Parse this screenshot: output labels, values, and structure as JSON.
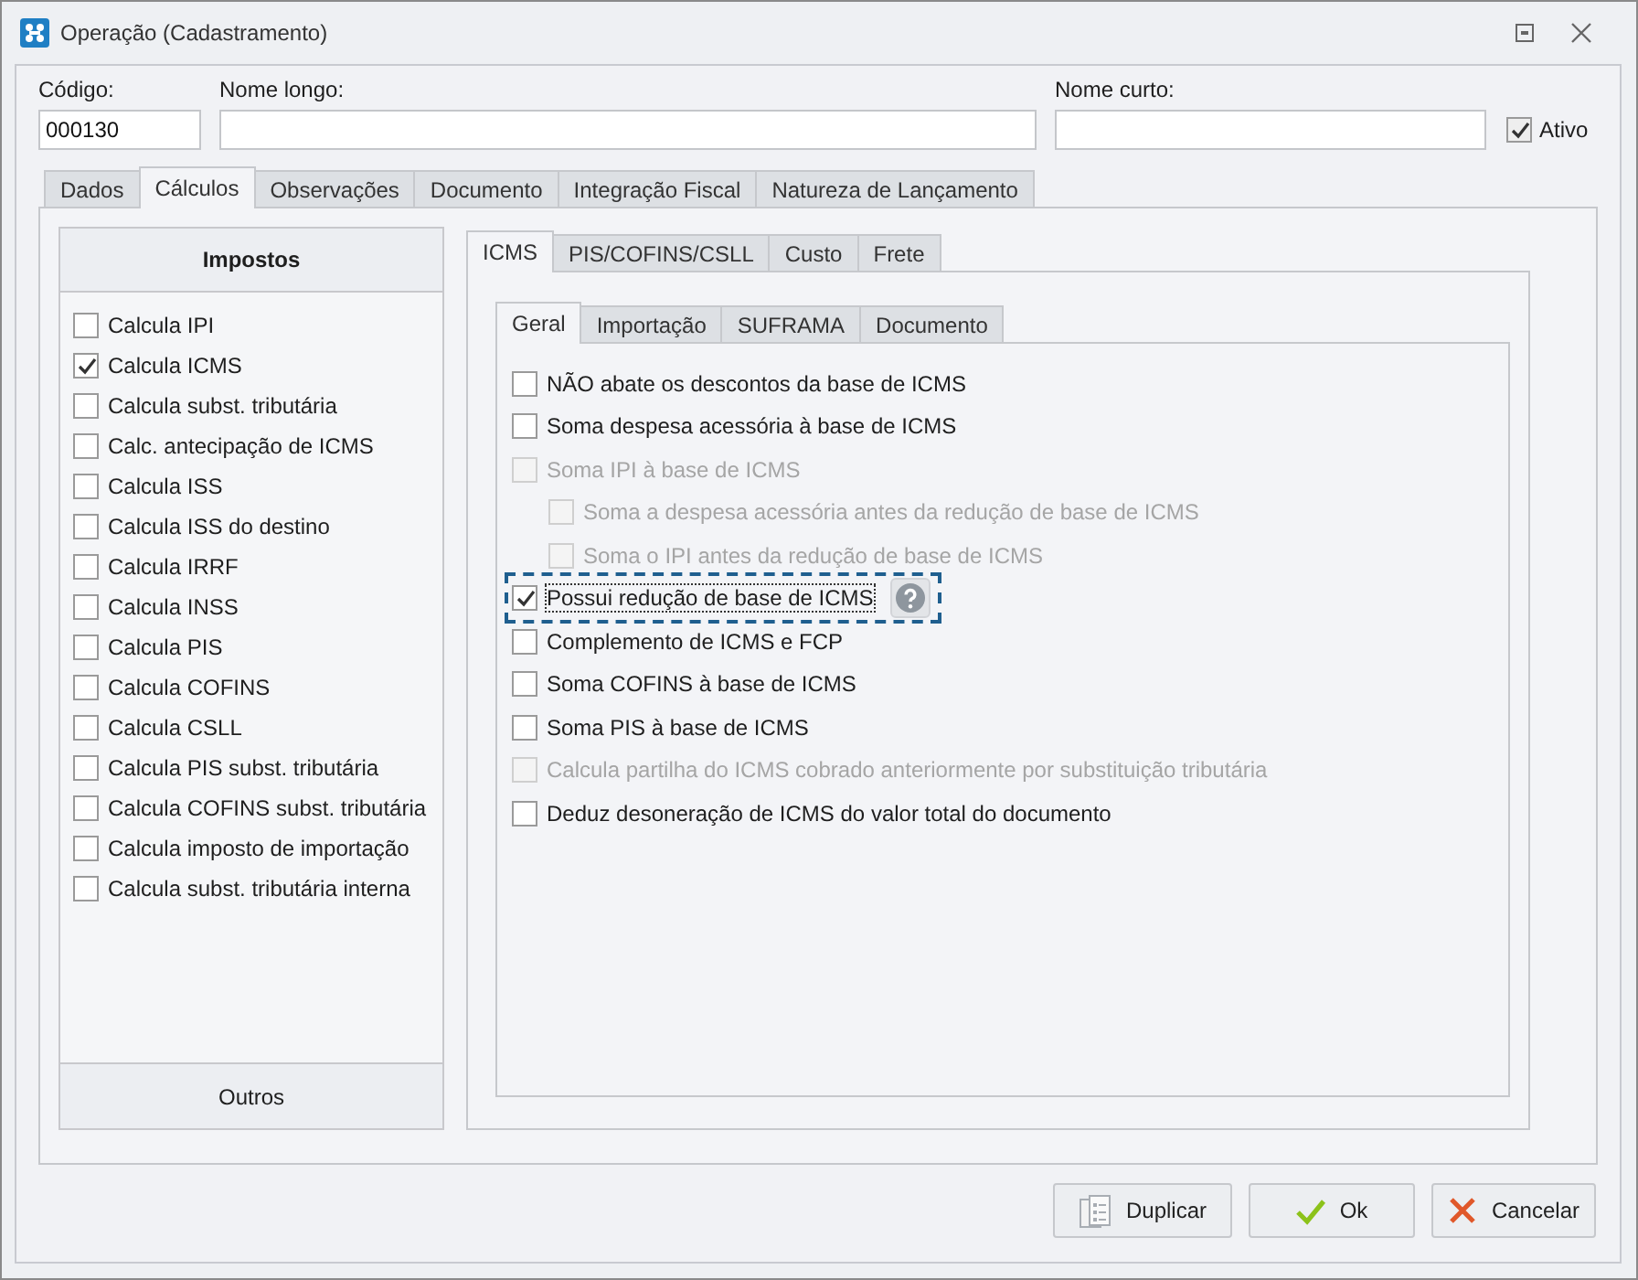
{
  "window": {
    "title": "Operação (Cadastramento)"
  },
  "fields": [
    {
      "label": "Código:",
      "value": "000130",
      "kind": "code"
    },
    {
      "label": "Nome longo:",
      "kind": "long"
    },
    {
      "label": "Nome curto:",
      "kind": "short"
    }
  ],
  "ativo": {
    "label": "Ativo",
    "checked": true
  },
  "tabs": [
    {
      "label": "Dados",
      "selected": false
    },
    {
      "label": "Cálculos",
      "selected": true
    },
    {
      "label": "Observações",
      "selected": false
    },
    {
      "label": "Documento",
      "selected": false
    },
    {
      "label": "Integração Fiscal",
      "selected": false
    },
    {
      "label": "Natureza de Lançamento",
      "selected": false
    }
  ],
  "impostos": {
    "title": "Impostos",
    "footer": "Outros",
    "items": [
      {
        "label": "Calcula IPI",
        "checked": false
      },
      {
        "label": "Calcula ICMS",
        "checked": true
      },
      {
        "label": "Calcula subst. tributária",
        "checked": false
      },
      {
        "label": "Calc. antecipação de ICMS",
        "checked": false
      },
      {
        "label": "Calcula ISS",
        "checked": false
      },
      {
        "label": "Calcula ISS do destino",
        "checked": false
      },
      {
        "label": "Calcula IRRF",
        "checked": false
      },
      {
        "label": "Calcula INSS",
        "checked": false
      },
      {
        "label": "Calcula PIS",
        "checked": false
      },
      {
        "label": "Calcula COFINS",
        "checked": false
      },
      {
        "label": "Calcula CSLL",
        "checked": false
      },
      {
        "label": "Calcula PIS subst. tributária",
        "checked": false
      },
      {
        "label": "Calcula COFINS subst. tributária",
        "checked": false
      },
      {
        "label": "Calcula imposto de importação",
        "checked": false
      },
      {
        "label": "Calcula subst. tributária interna",
        "checked": false
      }
    ]
  },
  "tax_tabs": [
    {
      "label": "ICMS",
      "selected": true
    },
    {
      "label": "PIS/COFINS/CSLL",
      "selected": false
    },
    {
      "label": "Custo",
      "selected": false
    },
    {
      "label": "Frete",
      "selected": false
    }
  ],
  "icms_tabs": [
    {
      "label": "Geral",
      "selected": true
    },
    {
      "label": "Importação",
      "selected": false
    },
    {
      "label": "SUFRAMA",
      "selected": false
    },
    {
      "label": "Documento",
      "selected": false
    }
  ],
  "options": [
    {
      "label": "NÃO abate os descontos da base de ICMS",
      "checked": false,
      "disabled": false
    },
    {
      "label": "Soma despesa acessória à base de ICMS",
      "checked": false,
      "disabled": false
    },
    {
      "label": "Soma IPI à base de ICMS",
      "checked": false,
      "disabled": true,
      "children": [
        {
          "label": "Soma a despesa acessória antes da redução de base de ICMS",
          "checked": false,
          "disabled": true
        },
        {
          "label": "Soma o IPI antes da redução de base de ICMS",
          "checked": false,
          "disabled": true
        }
      ]
    },
    {
      "label": "Possui redução de base de ICMS",
      "checked": true,
      "disabled": false,
      "highlighted": true,
      "help": true
    },
    {
      "label": "Complemento de ICMS e FCP",
      "checked": false,
      "disabled": false
    },
    {
      "label": "Soma COFINS à base de ICMS",
      "checked": false,
      "disabled": false
    },
    {
      "label": "Soma PIS à base de ICMS",
      "checked": false,
      "disabled": false
    },
    {
      "label": "Calcula partilha do ICMS cobrado anteriormente por substituição tributária",
      "checked": false,
      "disabled": true
    },
    {
      "label": "Deduz desoneração de ICMS do valor total do documento",
      "checked": false,
      "disabled": false
    }
  ],
  "buttons": [
    {
      "label": "Duplicar",
      "kind": "duplicate"
    },
    {
      "label": "Ok",
      "kind": "ok"
    },
    {
      "label": "Cancelar",
      "kind": "cancel"
    }
  ]
}
